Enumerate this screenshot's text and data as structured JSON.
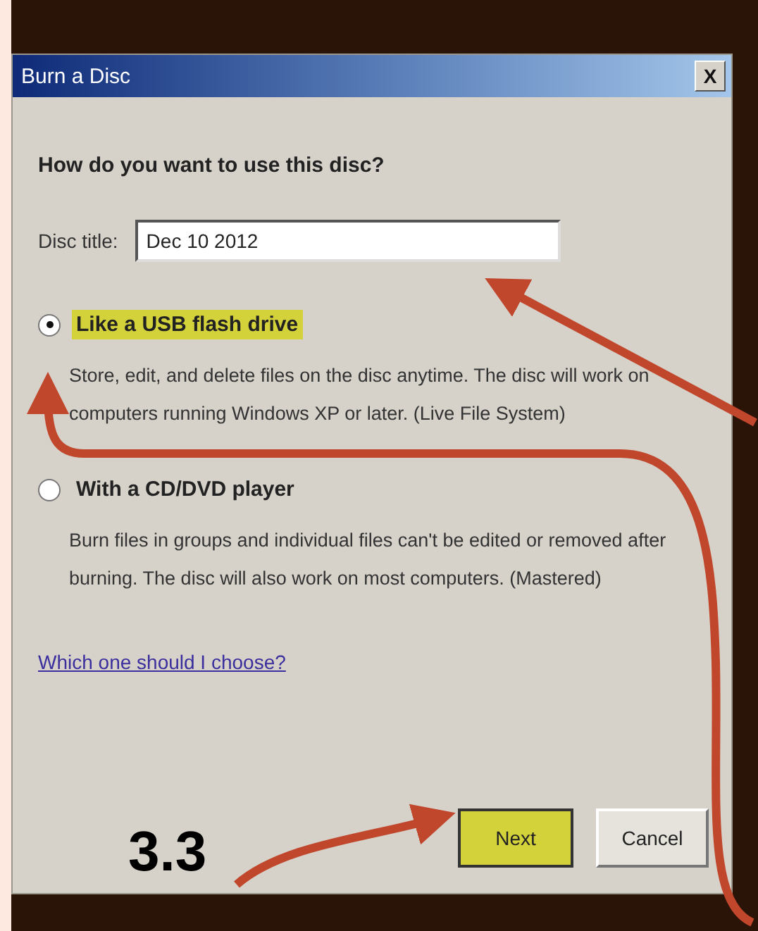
{
  "window": {
    "title": "Burn a Disc",
    "close": "X"
  },
  "question": "How do you want to use this disc?",
  "disc_title": {
    "label": "Disc title:",
    "value": "Dec 10 2012"
  },
  "options": [
    {
      "label": "Like a USB flash drive",
      "description": "Store, edit, and delete files on the disc anytime. The disc will work on computers running Windows XP or later. (Live File System)",
      "selected": true
    },
    {
      "label": "With a CD/DVD player",
      "description": "Burn files in groups and individual files can't be edited or removed after burning. The disc will also work on most computers. (Mastered)",
      "selected": false
    }
  ],
  "help_link": "Which one should I choose?",
  "buttons": [
    {
      "label": "Next",
      "highlighted": true
    },
    {
      "label": "Cancel",
      "highlighted": false
    }
  ],
  "annotation": {
    "label": "3.3"
  }
}
